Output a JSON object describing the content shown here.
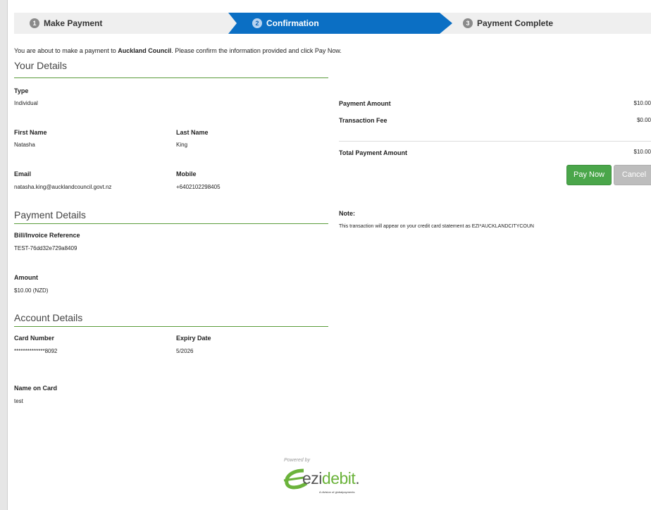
{
  "steps": [
    {
      "num": "1",
      "label": "Make Payment"
    },
    {
      "num": "2",
      "label": "Confirmation"
    },
    {
      "num": "3",
      "label": "Payment Complete"
    }
  ],
  "intro": {
    "before": "You are about to make a payment to ",
    "payee": "Auckland Council",
    "after": ". Please confirm the information provided and click Pay Now."
  },
  "your_details": {
    "title": "Your Details",
    "type_label": "Type",
    "type_value": "Individual",
    "first_name_label": "First Name",
    "first_name_value": "Natasha",
    "last_name_label": "Last Name",
    "last_name_value": "King",
    "email_label": "Email",
    "email_value": "natasha.king@aucklandcouncil.govt.nz",
    "mobile_label": "Mobile",
    "mobile_value": "+6402102298405"
  },
  "payment_details": {
    "title": "Payment Details",
    "reference_label": "Bill/Invoice Reference",
    "reference_value": "TEST-76dd32e729a8409",
    "amount_label": "Amount",
    "amount_value": "$10.00 (NZD)"
  },
  "account_details": {
    "title": "Account Details",
    "card_number_label": "Card Number",
    "card_number_value": "**************8092",
    "expiry_label": "Expiry Date",
    "expiry_value": "5/2026",
    "name_on_card_label": "Name on Card",
    "name_on_card_value": "test"
  },
  "summary": {
    "payment_amount_label": "Payment Amount",
    "payment_amount_value": "$10.00",
    "transaction_fee_label": "Transaction Fee",
    "transaction_fee_value": "$0.00",
    "total_label": "Total Payment Amount",
    "total_value": "$10.00"
  },
  "buttons": {
    "pay_now": "Pay Now",
    "cancel": "Cancel"
  },
  "note": {
    "label": "Note:",
    "text": "This transaction will appear on your credit card statement as EZI*AUCKLANDCITYCOUN"
  },
  "footer": {
    "powered_by": "Powered by",
    "logo_part1": "ezi",
    "logo_part2": "debit",
    "logo_suffix": ".",
    "logo_tagline": "A division of globalpayments"
  },
  "colors": {
    "active_step": "#0b6fc4",
    "accent_green": "#5b9c3b",
    "pay_button": "#4aa64a",
    "cancel_button": "#bdbdbd"
  }
}
